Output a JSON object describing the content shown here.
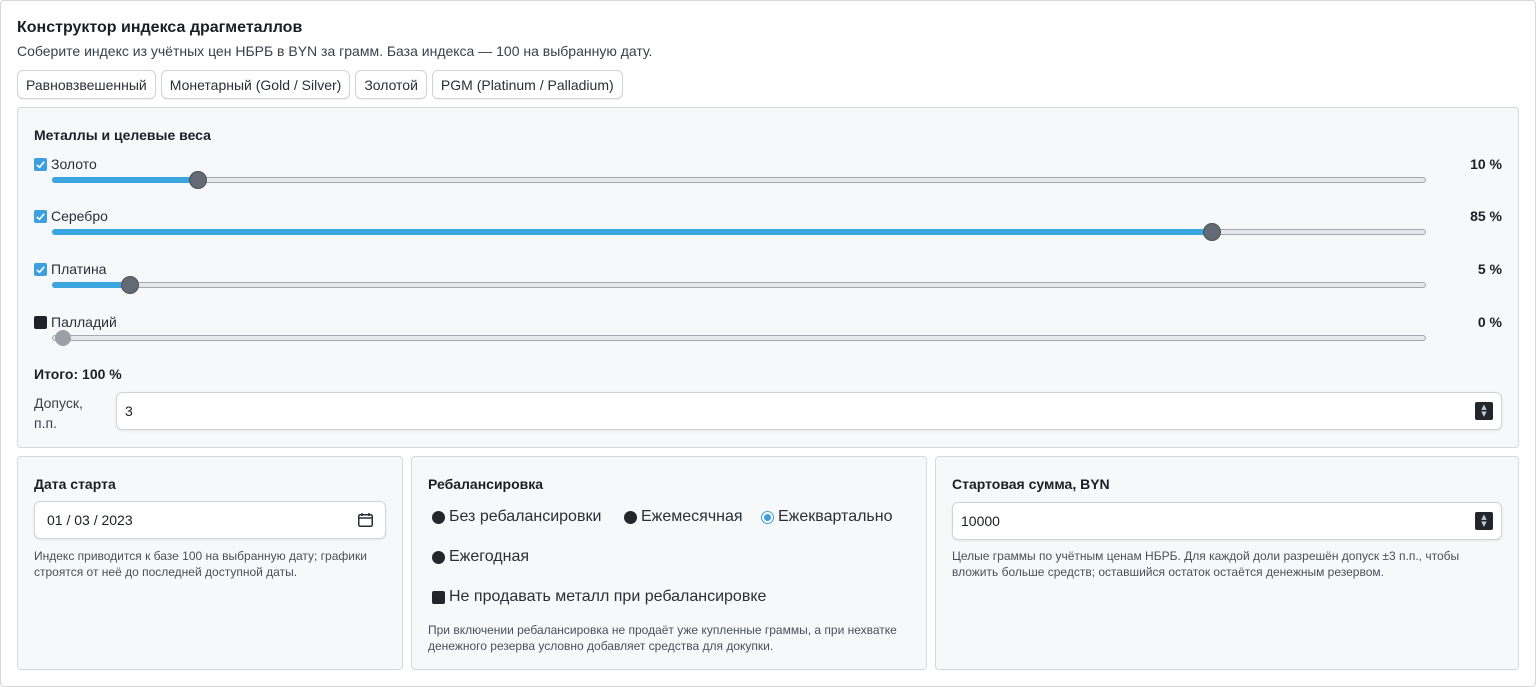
{
  "header": {
    "title": "Конструктор индекса драгметаллов",
    "subtitle": "Соберите индекс из учётных цен НБРБ в BYN за грамм. База индекса — 100 на выбранную дату."
  },
  "presets": [
    {
      "label": "Равновзвешенный"
    },
    {
      "label": "Монетарный (Gold / Silver)"
    },
    {
      "label": "Золотой"
    },
    {
      "label": "PGM (Platinum / Palladium)"
    }
  ],
  "metals_panel": {
    "title": "Металлы и целевые веса",
    "metals": [
      {
        "name": "Золото",
        "checked": true,
        "weight_label": "10 %",
        "slider_fraction": 0.106
      },
      {
        "name": "Серебро",
        "checked": true,
        "weight_label": "85 %",
        "slider_fraction": 0.845
      },
      {
        "name": "Платина",
        "checked": true,
        "weight_label": "5 %",
        "slider_fraction": 0.056
      },
      {
        "name": "Палладий",
        "checked": false,
        "weight_label": "0 %",
        "slider_fraction": 0.007
      }
    ],
    "total_label": "Итого: 100 %",
    "tolerance_label": "Допуск, п.п.",
    "tolerance_value": "3"
  },
  "start_date": {
    "title": "Дата старта",
    "value": "01 / 03 / 2023",
    "hint": "Индекс приводится к базе 100 на выбранную дату; графики строятся от неё до последней доступной даты."
  },
  "rebalancing": {
    "title": "Ребалансировка",
    "options": [
      {
        "label": "Без ребалансировки",
        "selected": false
      },
      {
        "label": "Ежемесячная",
        "selected": false
      },
      {
        "label": "Ежеквартально",
        "selected": true
      },
      {
        "label": "Ежегодная",
        "selected": false
      }
    ],
    "no_sell_label": "Не продавать металл при ребалансировке",
    "no_sell_checked": false,
    "hint": "При включении ребалансировка не продаёт уже купленные граммы, а при нехватке денежного резерва условно добавляет средства для докупки."
  },
  "start_amount": {
    "title": "Стартовая сумма, BYN",
    "value": "10000",
    "hint": "Целые граммы по учётным ценам НБРБ. Для каждой доли разрешён допуск ±3 п.п., чтобы вложить больше средств; оставшийся остаток остаётся денежным резервом."
  },
  "colors": {
    "accent": "#3ba5e0",
    "thumb": "#636a74",
    "panel_bg": "#f7f8fa"
  }
}
